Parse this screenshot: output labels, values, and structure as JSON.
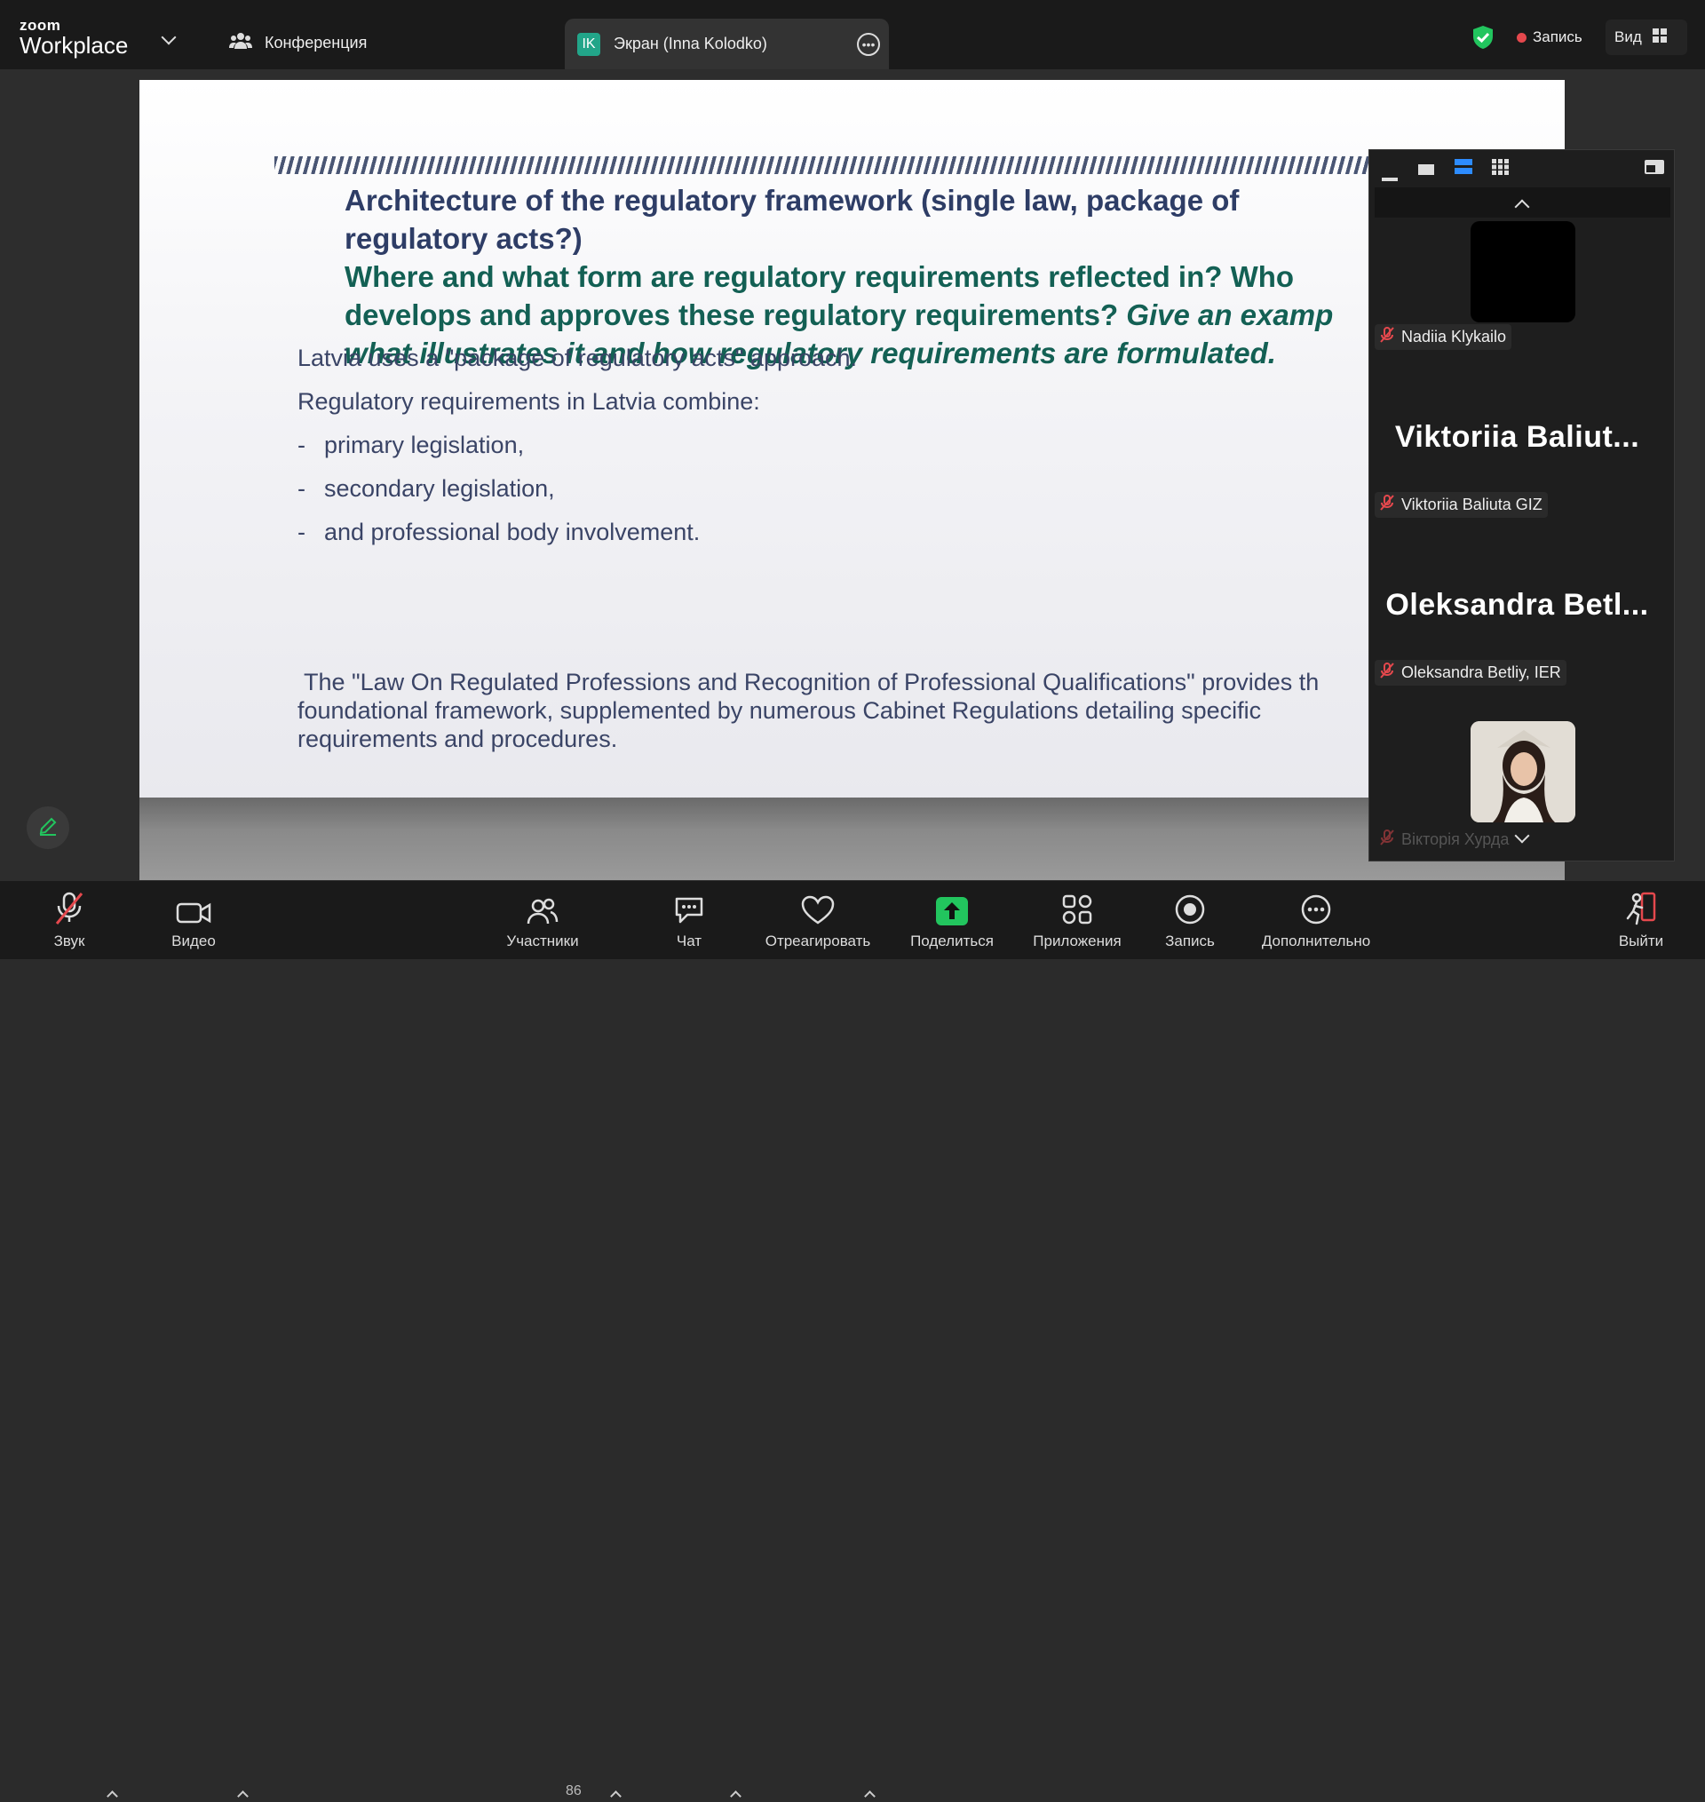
{
  "app": {
    "logo_line1": "zoom",
    "logo_line2": "Workplace"
  },
  "tabs": {
    "conference": "Конференция",
    "screen_badge": "IK",
    "screen": "Экран (Inna Kolodko)"
  },
  "header": {
    "recording": "Запись",
    "view": "Вид"
  },
  "slide": {
    "title_line1": "Architecture of the regulatory framework (single law, package of",
    "title_line2": "regulatory acts?)",
    "q_line1": "Where and what form are regulatory requirements reflected in? Who",
    "q_line2_normal": "develops and approves these regulatory requirements? ",
    "q_line2_italic": "Give an examp",
    "q_line3_italic": "what illustrates it and how regulatory requirements are formulated.",
    "text1": "Latvia uses a \"package of regulatory acts\" approach.",
    "text2": "Regulatory requirements in Latvia combine:",
    "bullets": [
      "primary legislation,",
      "secondary legislation,",
      "and professional body involvement."
    ],
    "para_line1": " The \"Law On Regulated Professions and Recognition of Professional Qualifications\" provides th",
    "para_line2": "foundational framework, supplemented by numerous Cabinet Regulations detailing specific",
    "para_line3": "requirements and procedures."
  },
  "participants_panel": {
    "tiles": [
      {
        "name": "Nadiia Klykailo",
        "display": ""
      },
      {
        "name": "Viktoriia Baliuta GIZ",
        "display": "Viktoriia  Baliut..."
      },
      {
        "name": "Oleksandra Betliy, IER",
        "display": "Oleksandra  Betl..."
      },
      {
        "name": "Вікторія Хурда",
        "display": ""
      }
    ]
  },
  "toolbar": {
    "audio": "Звук",
    "video": "Видео",
    "participants": "Участники",
    "participants_count": "86",
    "chat": "Чат",
    "react": "Отреагировать",
    "share": "Поделиться",
    "apps": "Приложения",
    "record": "Запись",
    "more": "Дополнительно",
    "leave": "Выйти"
  },
  "colors": {
    "accent_green": "#22c55e",
    "record_red": "#e5484d",
    "panel_blue": "#2d8cff"
  }
}
